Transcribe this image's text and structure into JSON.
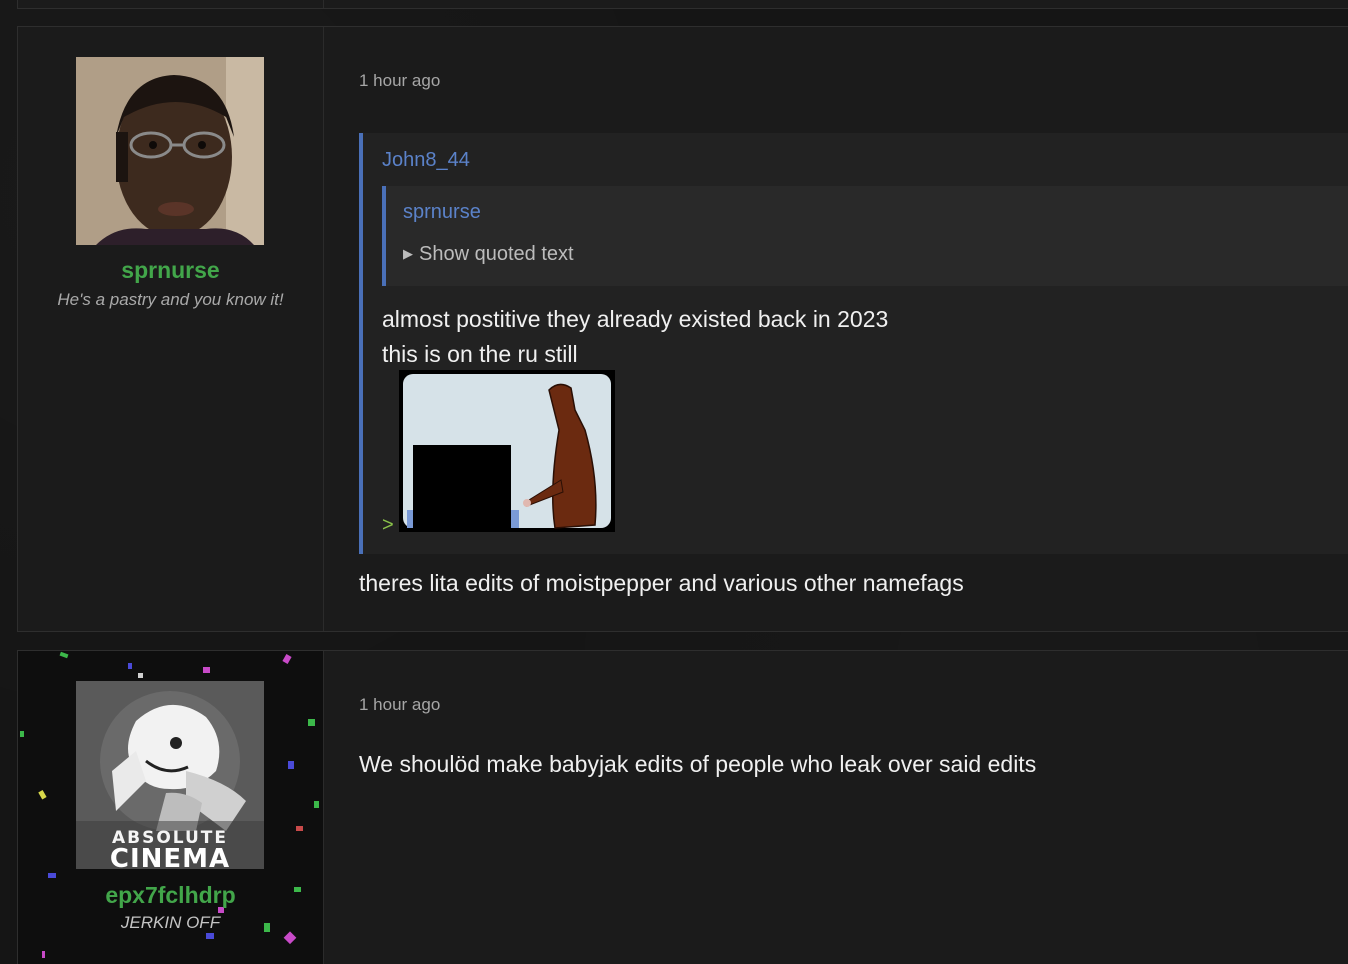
{
  "posts": [
    {
      "author": "sprnurse",
      "user_title": "He's a pastry and you know it!",
      "timestamp": "1 hour ago",
      "quote": {
        "author": "John8_44",
        "inner_quote": {
          "author": "sprnurse",
          "toggle_label": "Show quoted text"
        },
        "lines": [
          "almost postitive they already existed back in 2023",
          "this is on the ru still"
        ],
        "greentext_marker": ">"
      },
      "reply": "theres lita edits of moistpepper and various other namefags"
    },
    {
      "author": "epx7fclhdrp",
      "user_title": "JERKIN OFF",
      "timestamp": "1 hour ago",
      "avatar_text_top": "ABSOLUTE",
      "avatar_text_bottom": "CINEMA",
      "reply": "We shoulöd make babyjak edits of people who leak over said edits"
    }
  ],
  "colors": {
    "username": "#42a64a",
    "quote_border": "#4a70b8",
    "quote_author": "#5b82c9",
    "greentext": "#8ac34a"
  }
}
